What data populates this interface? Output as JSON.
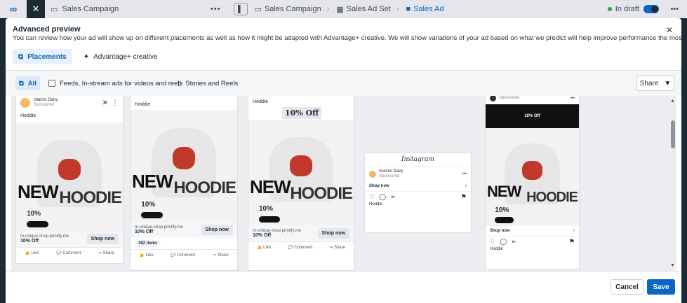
{
  "topbar": {
    "campaign_name": "Sales Campaign",
    "more": "•••",
    "breadcrumbs": [
      "Sales Campaign",
      "Sales Ad Set",
      "Sales Ad"
    ],
    "status": "In draft"
  },
  "modal": {
    "title": "Advanced preview",
    "subtitle": "You can review how your ad will show up on different placements as well as how it might be adapted with Advantage+ creative. We will show variations of your ad based on what we predict will help improve performance the most.",
    "tabs": [
      "Placements",
      "Advantage+ creative"
    ],
    "filters": [
      "All",
      "Feeds, In-stream ads for videos and reels",
      "Stories and Reels"
    ],
    "share_label": "Share",
    "cancel_label": "Cancel",
    "save_label": "Save"
  },
  "ad": {
    "page_name": "Islamic Dairy",
    "sponsored": "Sponsored",
    "primary_text": "Hoddie",
    "headline_new": "NEW",
    "headline_hoodie": "HOODIE",
    "discount": "10%",
    "offer": "10% Off",
    "url": "m-unique-shop.printify.me",
    "cta": "Shop now",
    "items": "392 items",
    "like": "Like",
    "comment": "Comment",
    "share": "Share",
    "instagram": "Instagram"
  },
  "colors": {
    "accent": "#0a66c2",
    "modal_bg": "#ffffff",
    "dark": "#1c2b33"
  }
}
